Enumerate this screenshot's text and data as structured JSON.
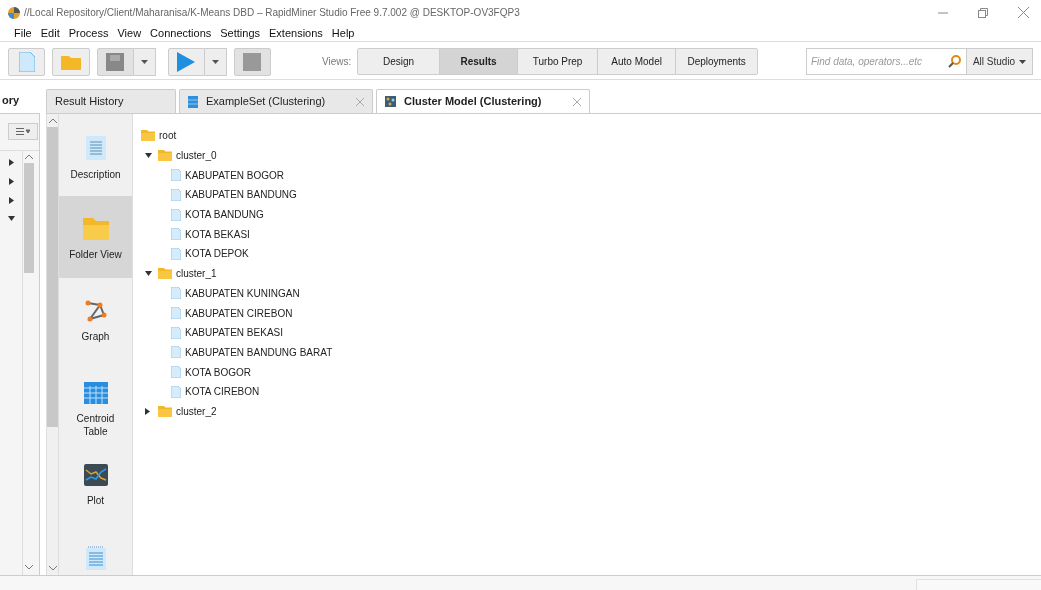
{
  "window": {
    "title": "//Local Repository/Client/Maharanisa/K-Means DBD – RapidMiner Studio Free 9.7.002 @ DESKTOP-OV3FQP3"
  },
  "menu": [
    "File",
    "Edit",
    "Process",
    "View",
    "Connections",
    "Settings",
    "Extensions",
    "Help"
  ],
  "toolbar": {
    "views_label": "Views:",
    "views": [
      {
        "label": "Design",
        "selected": false
      },
      {
        "label": "Results",
        "selected": true
      },
      {
        "label": "Turbo Prep",
        "selected": false
      },
      {
        "label": "Auto Model",
        "selected": false
      },
      {
        "label": "Deployments",
        "selected": false
      }
    ],
    "search": {
      "placeholder": "Find data, operators...etc"
    },
    "scope": "All Studio"
  },
  "left_panel": {
    "tab": "ory",
    "nodes": [
      {
        "expanded": false
      },
      {
        "expanded": false
      },
      {
        "expanded": false
      },
      {
        "expanded": true
      }
    ]
  },
  "tabs": [
    {
      "label": "Result History",
      "kind": "plain",
      "selected": false
    },
    {
      "label": "ExampleSet (Clustering)",
      "kind": "table",
      "selected": false
    },
    {
      "label": "Cluster Model (Clustering)",
      "kind": "model",
      "selected": true
    }
  ],
  "side_nav": [
    {
      "label": "Description",
      "kind": "description",
      "selected": false
    },
    {
      "label": "Folder View",
      "kind": "folder",
      "selected": true
    },
    {
      "label": "Graph",
      "kind": "graph",
      "selected": false
    },
    {
      "label": "Centroid Table",
      "kind": "table",
      "selected": false
    },
    {
      "label": "Plot",
      "kind": "plot",
      "selected": false
    },
    {
      "kind": "text",
      "selected": false
    }
  ],
  "tree": [
    {
      "label": "root",
      "kind": "folder",
      "children": [
        {
          "label": "cluster_0",
          "kind": "folder",
          "expanded": true,
          "children": [
            {
              "label": "KABUPATEN BOGOR",
              "kind": "file"
            },
            {
              "label": "KABUPATEN BANDUNG",
              "kind": "file"
            },
            {
              "label": "KOTA BANDUNG",
              "kind": "file"
            },
            {
              "label": "KOTA BEKASI",
              "kind": "file"
            },
            {
              "label": "KOTA DEPOK",
              "kind": "file"
            }
          ]
        },
        {
          "label": "cluster_1",
          "kind": "folder",
          "expanded": true,
          "children": [
            {
              "label": "KABUPATEN KUNINGAN",
              "kind": "file"
            },
            {
              "label": "KABUPATEN CIREBON",
              "kind": "file"
            },
            {
              "label": "KABUPATEN BEKASI",
              "kind": "file"
            },
            {
              "label": "KABUPATEN BANDUNG BARAT",
              "kind": "file"
            },
            {
              "label": "KOTA BOGOR",
              "kind": "file"
            },
            {
              "label": "KOTA CIREBON",
              "kind": "file"
            }
          ]
        },
        {
          "label": "cluster_2",
          "kind": "folder",
          "expanded": false
        }
      ]
    }
  ]
}
